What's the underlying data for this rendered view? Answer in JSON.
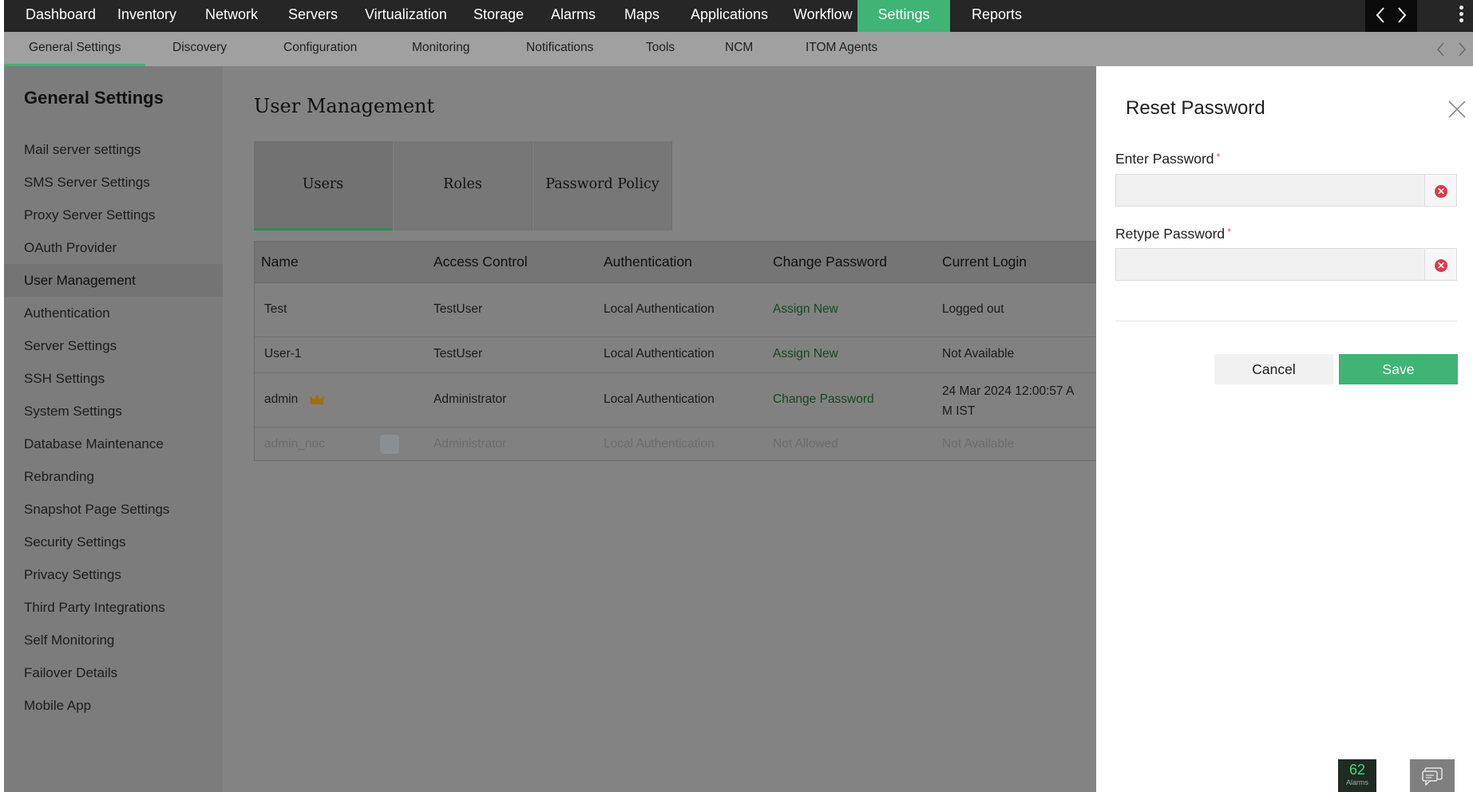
{
  "topnav": {
    "items": [
      "Dashboard",
      "Inventory",
      "Network",
      "Servers",
      "Virtualization",
      "Storage",
      "Alarms",
      "Maps",
      "Applications",
      "Workflow",
      "Settings",
      "Reports"
    ],
    "active": "Settings",
    "accent": "#3fb475"
  },
  "subnav": {
    "items": [
      "General Settings",
      "Discovery",
      "Configuration",
      "Monitoring",
      "Notifications",
      "Tools",
      "NCM",
      "ITOM Agents"
    ],
    "active": "General Settings"
  },
  "sidebar": {
    "title": "General Settings",
    "items": [
      "Mail server settings",
      "SMS Server Settings",
      "Proxy Server Settings",
      "OAuth Provider",
      "User Management",
      "Authentication",
      "Server Settings",
      "SSH Settings",
      "System Settings",
      "Database Maintenance",
      "Rebranding",
      "Snapshot Page Settings",
      "Security Settings",
      "Privacy Settings",
      "Third Party Integrations",
      "Self Monitoring",
      "Failover Details",
      "Mobile App"
    ],
    "active": "User Management"
  },
  "main": {
    "title": "User Management",
    "tabs": [
      "Users",
      "Roles",
      "Password Policy"
    ],
    "active_tab": "Users"
  },
  "table": {
    "columns": [
      "Name",
      "Access Control",
      "Authentication",
      "Change Password",
      "Current Login"
    ],
    "rows": [
      {
        "name": "Test",
        "access": "TestUser",
        "auth": "Local Authentication",
        "change": "Assign New",
        "login": "Logged out"
      },
      {
        "name": "User-1",
        "access": "TestUser",
        "auth": "Local Authentication",
        "change": "Assign New",
        "login": "Not Available"
      },
      {
        "name": "admin",
        "access": "Administrator",
        "auth": "Local Authentication",
        "change": "Change Password",
        "login": "24 Mar 2024 12:00:57 A M IST"
      },
      {
        "name": "admin_noc",
        "access": "Administrator",
        "auth": "Local Authentication",
        "change": "Not Allowed",
        "login": "Not Available"
      }
    ]
  },
  "panel": {
    "title": "Reset Password",
    "enter_label": "Enter Password",
    "retype_label": "Retype Password",
    "required_mark": "*",
    "cancel_label": "Cancel",
    "save_label": "Save"
  },
  "footer": {
    "alarm_count": "62",
    "alarm_label": "Alarms"
  }
}
